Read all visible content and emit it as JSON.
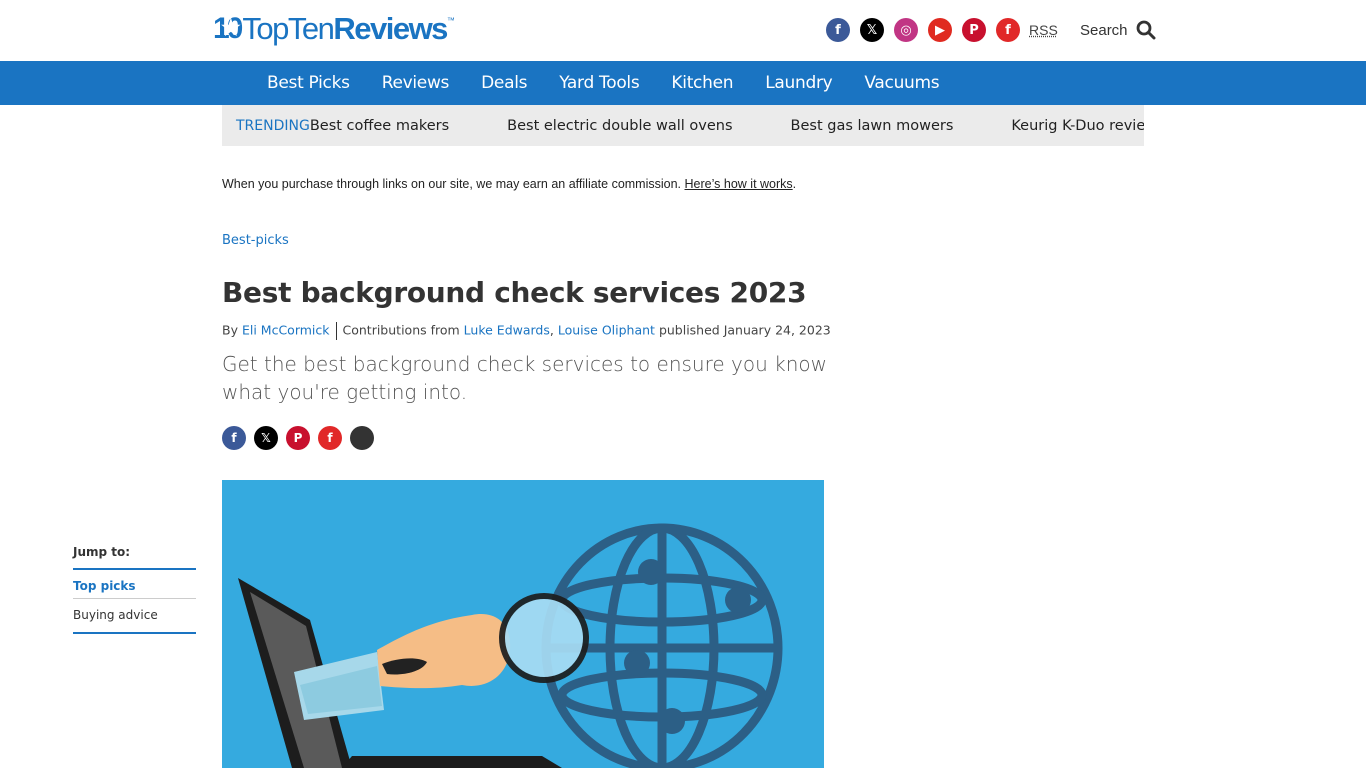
{
  "brand": {
    "logo_mark": "10",
    "logo_text_light": "Top",
    "logo_text_light2": "Ten",
    "logo_text_bold": "Reviews",
    "logo_tm": "™",
    "color": "#1a74c2"
  },
  "header": {
    "social": [
      {
        "name": "facebook-icon",
        "glyph": "f",
        "color": "#3b5998"
      },
      {
        "name": "x-icon",
        "glyph": "𝕏",
        "color": "#000000"
      },
      {
        "name": "instagram-icon",
        "glyph": "◎",
        "color": "#c13584"
      },
      {
        "name": "youtube-icon",
        "glyph": "▶",
        "color": "#e02a20"
      },
      {
        "name": "pinterest-icon",
        "glyph": "P",
        "color": "#c8102e"
      },
      {
        "name": "flipboard-icon",
        "glyph": "f",
        "color": "#e12828"
      }
    ],
    "rss_label": "RSS",
    "search_label": "Search"
  },
  "nav": {
    "items": [
      "Best Picks",
      "Reviews",
      "Deals",
      "Yard Tools",
      "Kitchen",
      "Laundry",
      "Vacuums"
    ]
  },
  "trending": {
    "label": "TRENDING",
    "items": [
      "Best coffee makers",
      "Best electric double wall ovens",
      "Best gas lawn mowers",
      "Keurig K-Duo review"
    ]
  },
  "affiliate": {
    "text": "When you purchase through links on our site, we may earn an affiliate commission.",
    "link": "Here’s how it works",
    "end": "."
  },
  "article": {
    "breadcrumb": "Best-picks",
    "title": "Best background check services 2023",
    "by": "By",
    "author": "Eli McCormick",
    "contributions_from": "Contributions from",
    "contributor1": "Luke Edwards",
    "comma": ",",
    "contributor2": "Louise Oliphant",
    "published": "published January 24, 2023",
    "subtitle": "Get the best background check services to ensure you know what you're getting into."
  },
  "share": [
    {
      "name": "share-facebook-icon",
      "glyph": "f",
      "color": "#3b5998"
    },
    {
      "name": "share-x-icon",
      "glyph": "𝕏",
      "color": "#000000"
    },
    {
      "name": "share-pinterest-icon",
      "glyph": "P",
      "color": "#c8102e"
    },
    {
      "name": "share-flipboard-icon",
      "glyph": "f",
      "color": "#e12828"
    },
    {
      "name": "share-more-icon",
      "glyph": "",
      "color": "#333333"
    }
  ],
  "jump": {
    "title": "Jump to:",
    "items": [
      "Top picks",
      "Buying advice"
    ]
  }
}
